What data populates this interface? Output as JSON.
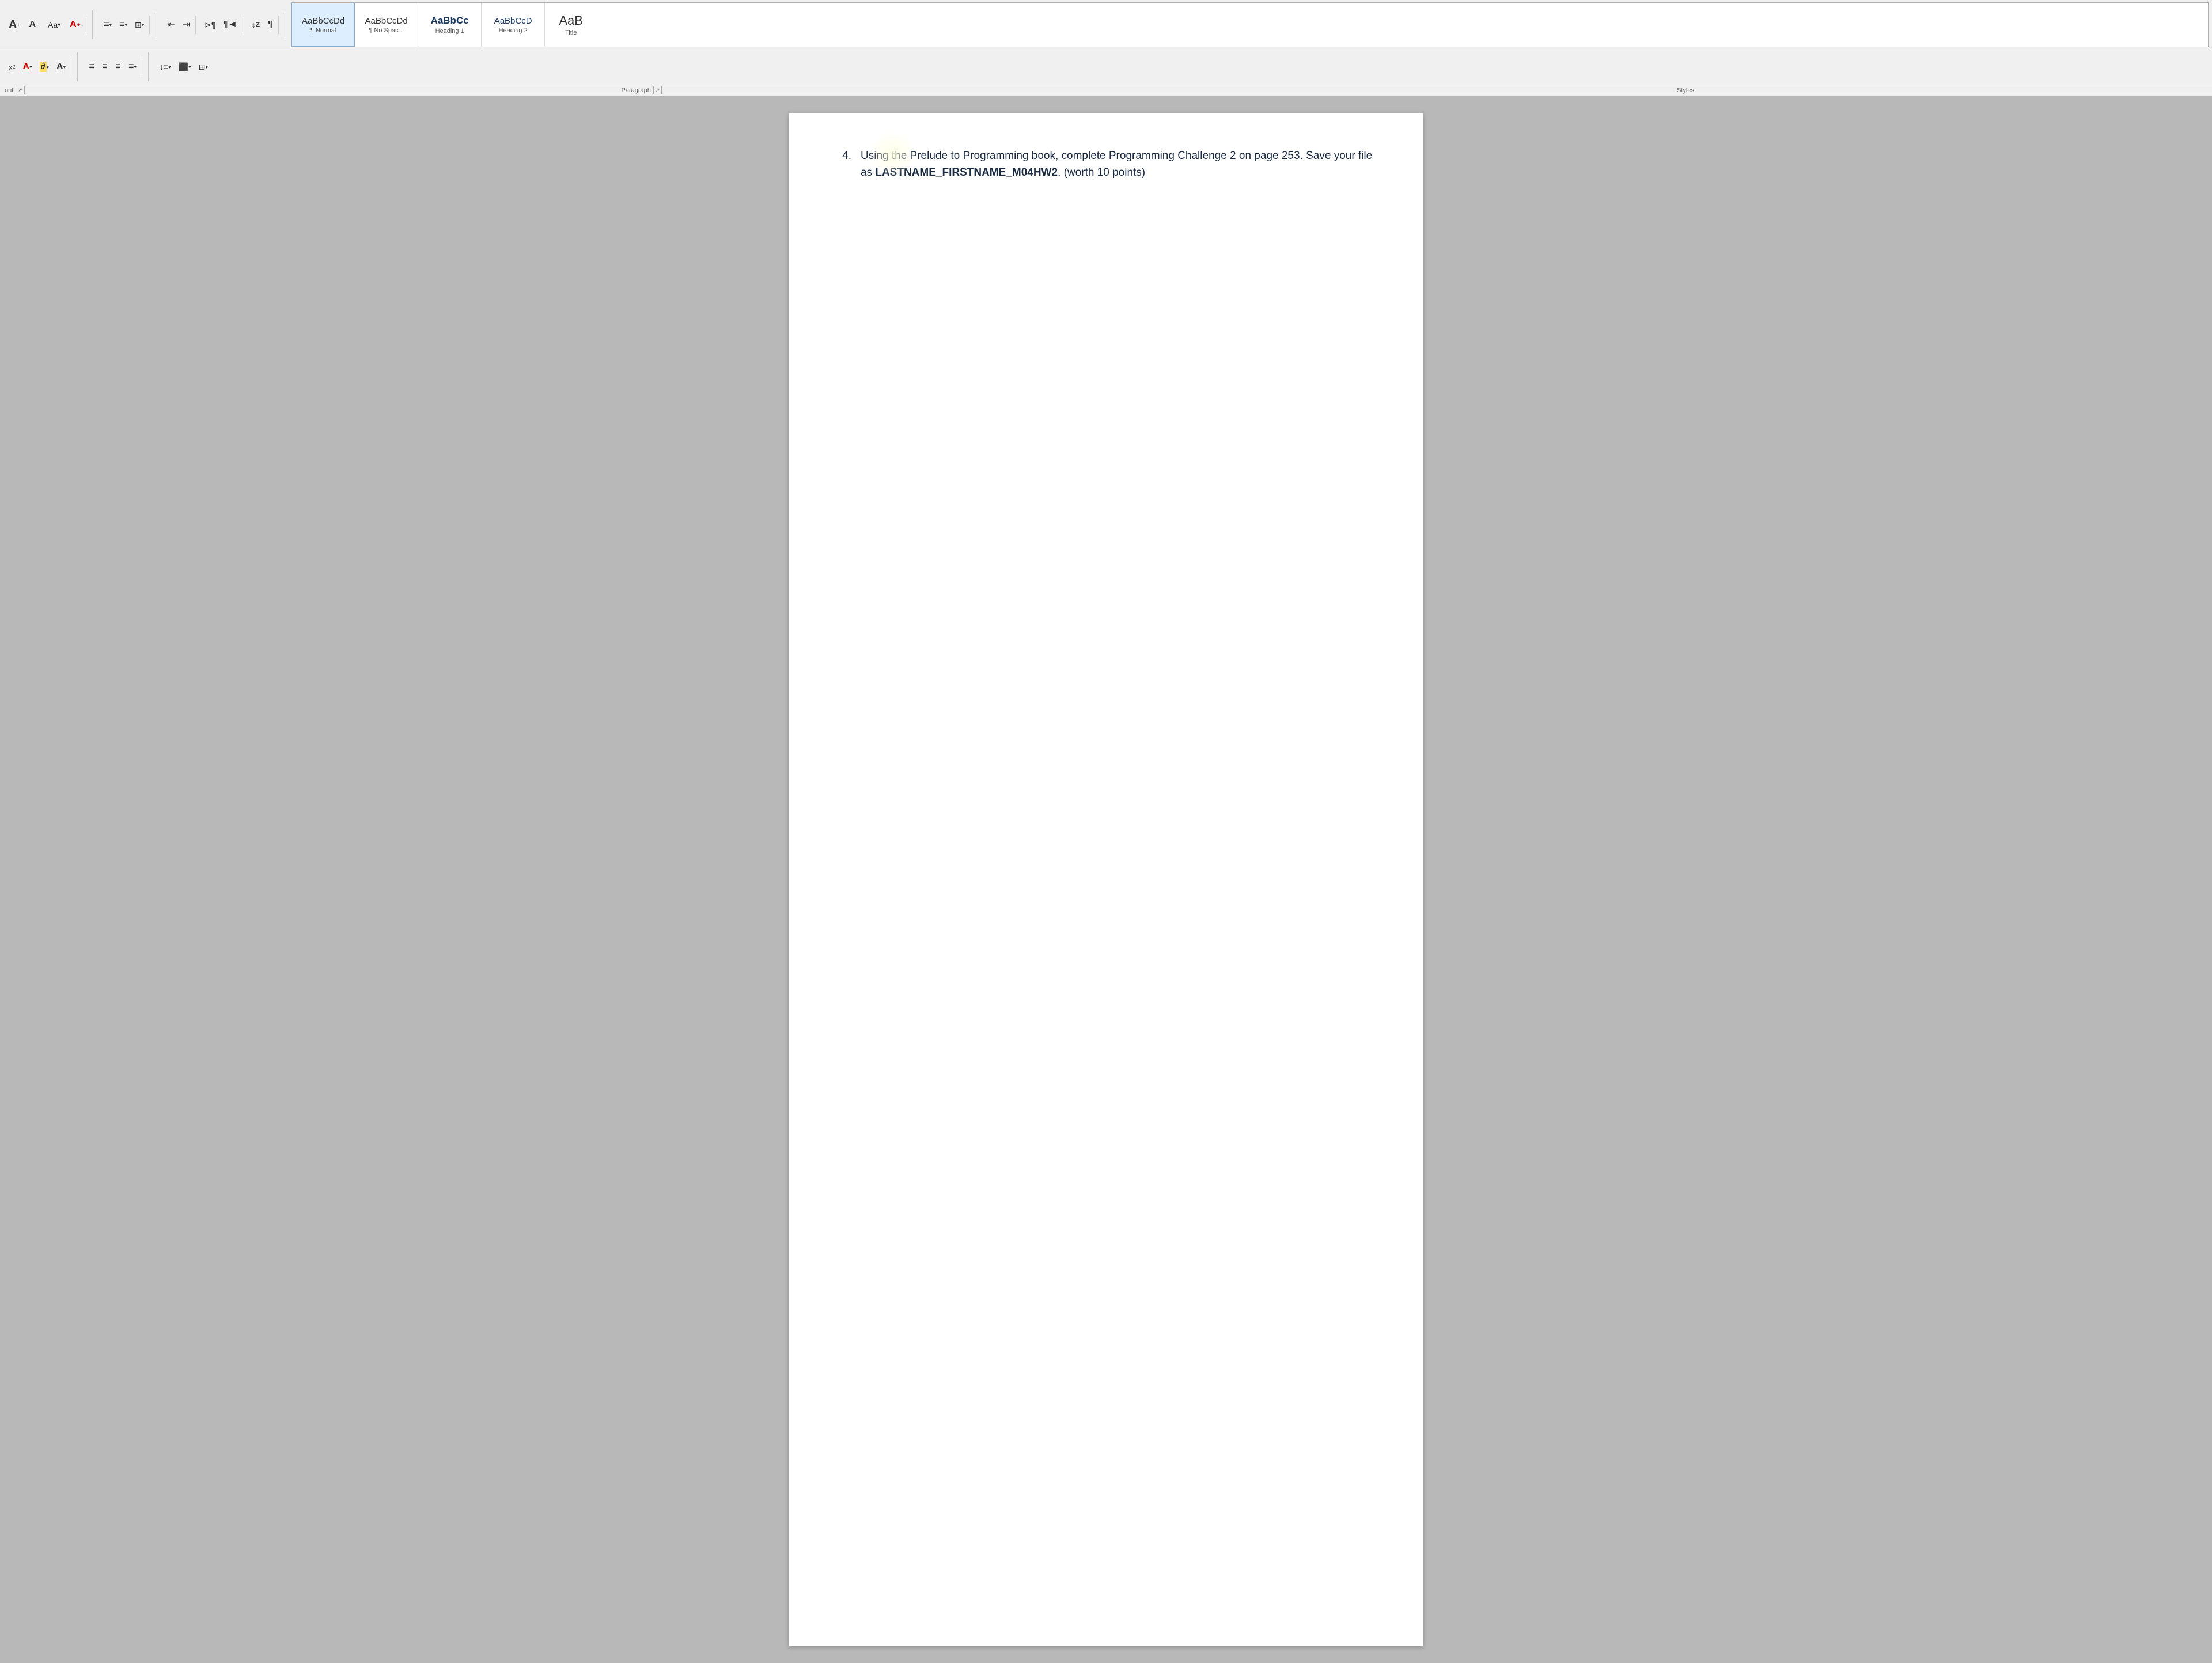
{
  "ribbon": {
    "row1": {
      "font_buttons": [
        {
          "id": "font-grow-up",
          "label": "A↑",
          "title": "Increase Font Size"
        },
        {
          "id": "font-grow-down",
          "label": "A↓",
          "title": "Decrease Font Size"
        },
        {
          "id": "aa-btn",
          "label": "Aa▾",
          "title": "Change Case"
        },
        {
          "id": "clear-format",
          "label": "A✦",
          "title": "Clear Formatting"
        }
      ],
      "list_buttons": [
        {
          "id": "bullets",
          "label": "≡▾",
          "title": "Bullets"
        },
        {
          "id": "numbering",
          "label": "≡▾",
          "title": "Numbering"
        },
        {
          "id": "multilevel",
          "label": "⊞▾",
          "title": "Multilevel List"
        }
      ],
      "indent_buttons": [
        {
          "id": "decrease-indent",
          "label": "←≡",
          "title": "Decrease Indent"
        },
        {
          "id": "increase-indent",
          "label": "→≡",
          "title": "Increase Indent"
        }
      ],
      "para_marks": [
        {
          "id": "show-formatting",
          "label": "¶◄",
          "title": "Show/Hide"
        },
        {
          "id": "para-mark",
          "label": "¶",
          "title": "Paragraph Mark"
        }
      ],
      "sort_buttons": [
        {
          "id": "sort",
          "label": "↕Z",
          "title": "Sort"
        },
        {
          "id": "para-end",
          "label": "¶",
          "title": "Paragraph"
        }
      ]
    },
    "row2": {
      "align_buttons": [
        {
          "id": "align-left",
          "label": "≡",
          "title": "Align Left"
        },
        {
          "id": "align-center",
          "label": "≡",
          "title": "Center"
        },
        {
          "id": "align-right",
          "label": "≡",
          "title": "Align Right"
        },
        {
          "id": "align-justify",
          "label": "≡▾",
          "title": "Justify"
        }
      ],
      "spacing_buttons": [
        {
          "id": "line-spacing",
          "label": "↕≡▾",
          "title": "Line Spacing"
        },
        {
          "id": "shading",
          "label": "⬛▾",
          "title": "Shading"
        },
        {
          "id": "borders",
          "label": "⊞▾",
          "title": "Borders"
        }
      ]
    },
    "styles": [
      {
        "id": "normal",
        "preview": "AaBbCcDd",
        "label": "¶ Normal",
        "active": true
      },
      {
        "id": "no-spacing",
        "preview": "AaBbCcDd",
        "label": "¶ No Spac..."
      },
      {
        "id": "heading1",
        "preview": "AaBbCc",
        "label": "Heading 1"
      },
      {
        "id": "heading2",
        "preview": "AaBbCcD",
        "label": "Heading 2"
      },
      {
        "id": "title",
        "preview": "AaB",
        "label": "Title"
      }
    ],
    "footer": {
      "font_label": "ont",
      "paragraph_label": "Paragraph",
      "styles_label": "Styles"
    }
  },
  "document": {
    "items": [
      {
        "number": "4.",
        "text_before": "Using the Prelude to Programming book, complete Programming Challenge 2 on page 253. Save your file as ",
        "text_bold": "LASTNAME_FIRSTNAME_M04HW2",
        "text_after": ". (worth 10 points)"
      }
    ]
  }
}
